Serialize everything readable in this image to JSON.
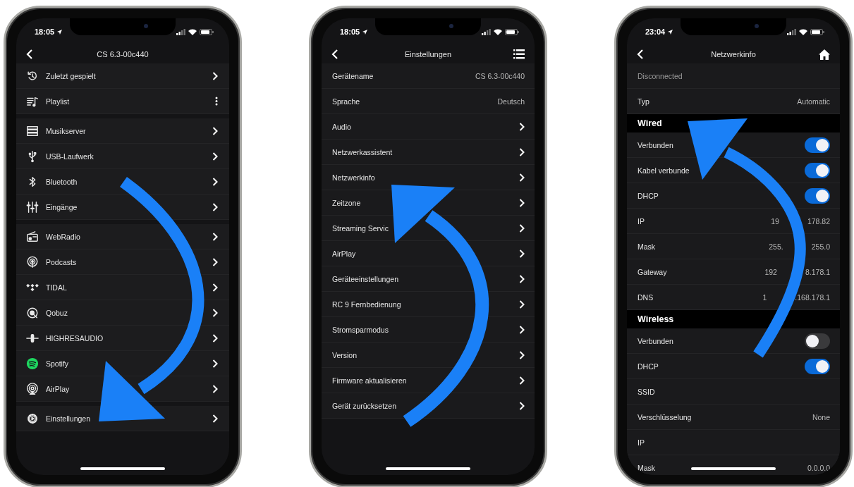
{
  "sources_screen": {
    "status_time": "18:05",
    "title": "CS 6.3-00c440",
    "groups": [
      {
        "items": [
          {
            "label": "Zuletzt gespielt",
            "kind": "link"
          },
          {
            "label": "Playlist",
            "kind": "more"
          }
        ]
      },
      {
        "items": [
          {
            "label": "Musikserver",
            "kind": "link"
          },
          {
            "label": "USB-Laufwerk",
            "kind": "link"
          },
          {
            "label": "Bluetooth",
            "kind": "link"
          },
          {
            "label": "Eingänge",
            "kind": "link"
          }
        ]
      },
      {
        "items": [
          {
            "label": "WebRadio",
            "kind": "link"
          },
          {
            "label": "Podcasts",
            "kind": "link"
          },
          {
            "label": "TIDAL",
            "kind": "link"
          },
          {
            "label": "Qobuz",
            "kind": "link"
          },
          {
            "label": "HIGHRESAUDIO",
            "kind": "link"
          },
          {
            "label": "Spotify",
            "kind": "link"
          },
          {
            "label": "AirPlay",
            "kind": "link"
          }
        ]
      },
      {
        "items": [
          {
            "label": "Einstellungen",
            "kind": "link"
          }
        ]
      }
    ]
  },
  "settings_screen": {
    "status_time": "18:05",
    "title": "Einstellungen",
    "items": [
      {
        "label": "Gerätename",
        "kind": "value",
        "value": "CS 6.3-00c440"
      },
      {
        "label": "Sprache",
        "kind": "value",
        "value": "Deutsch"
      },
      {
        "label": "Audio",
        "kind": "link"
      },
      {
        "label": "Netzwerkassistent",
        "kind": "link"
      },
      {
        "label": "Netzwerkinfo",
        "kind": "link"
      },
      {
        "label": "Zeitzone",
        "kind": "link"
      },
      {
        "label": "Streaming Servic",
        "kind": "link"
      },
      {
        "label": "AirPlay",
        "kind": "link"
      },
      {
        "label": "Geräteeinstellungen",
        "kind": "link"
      },
      {
        "label": "RC 9 Fernbedienung",
        "kind": "link"
      },
      {
        "label": "Stromsparmodus",
        "kind": "link"
      },
      {
        "label": "Version",
        "kind": "link"
      },
      {
        "label": "Firmware aktualisieren",
        "kind": "link"
      },
      {
        "label": "Gerät zurücksetzen",
        "kind": "link"
      }
    ]
  },
  "network_screen": {
    "status_time": "23:04",
    "title": "Netzwerkinfo",
    "rows": [
      {
        "kind": "note",
        "label": "Disconnected"
      },
      {
        "kind": "value",
        "label": "Typ",
        "value_parts": [
          "Automatic"
        ]
      },
      {
        "kind": "header",
        "label": "Wired"
      },
      {
        "kind": "toggle",
        "label": "Verbunden",
        "on": true
      },
      {
        "kind": "toggle",
        "label": "Kabel verbunde",
        "on": true
      },
      {
        "kind": "toggle",
        "label": "DHCP",
        "on": true
      },
      {
        "kind": "value",
        "label": "IP",
        "value_parts": [
          "19",
          "178.82"
        ]
      },
      {
        "kind": "value",
        "label": "Mask",
        "value_parts": [
          "255.",
          "255.0"
        ]
      },
      {
        "kind": "value",
        "label": "Gateway",
        "value_parts": [
          "192",
          "8.178.1"
        ]
      },
      {
        "kind": "value",
        "label": "DNS",
        "value_parts": [
          "1",
          ".168.178.1"
        ]
      },
      {
        "kind": "header",
        "label": "Wireless"
      },
      {
        "kind": "toggle",
        "label": "Verbunden",
        "on": false
      },
      {
        "kind": "toggle",
        "label": "DHCP",
        "on": true
      },
      {
        "kind": "value",
        "label": "SSID"
      },
      {
        "kind": "value",
        "label": "Verschlüsselung",
        "value_parts": [
          "None"
        ]
      },
      {
        "kind": "value",
        "label": "IP"
      },
      {
        "kind": "value",
        "label": "Mask",
        "value_parts": [
          "0.0.0.0"
        ]
      }
    ]
  }
}
